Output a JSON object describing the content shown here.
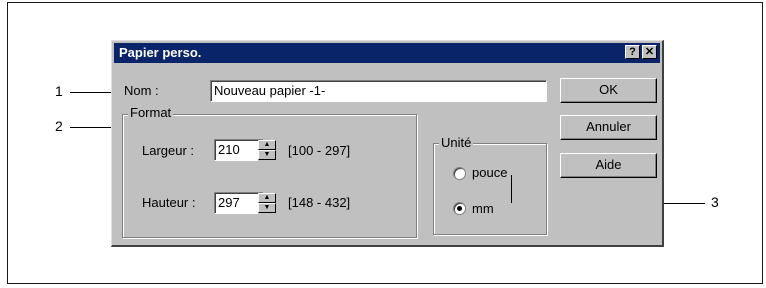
{
  "window": {
    "title": "Papier perso."
  },
  "titlebar_buttons": {
    "help": "?",
    "close": "✕"
  },
  "name_field": {
    "label": "Nom :",
    "value": "Nouveau papier -1-"
  },
  "format_group": {
    "legend": "Format",
    "width": {
      "label": "Largeur :",
      "value": "210",
      "range": "[100 - 297]"
    },
    "height": {
      "label": "Hauteur :",
      "value": "297",
      "range": "[148 - 432]"
    }
  },
  "unit_group": {
    "legend": "Unité",
    "options": [
      {
        "label": "pouce",
        "selected": false
      },
      {
        "label": "mm",
        "selected": true
      }
    ]
  },
  "buttons": {
    "ok": "OK",
    "cancel": "Annuler",
    "help": "Aide"
  },
  "callouts": [
    "1",
    "2",
    "3"
  ]
}
